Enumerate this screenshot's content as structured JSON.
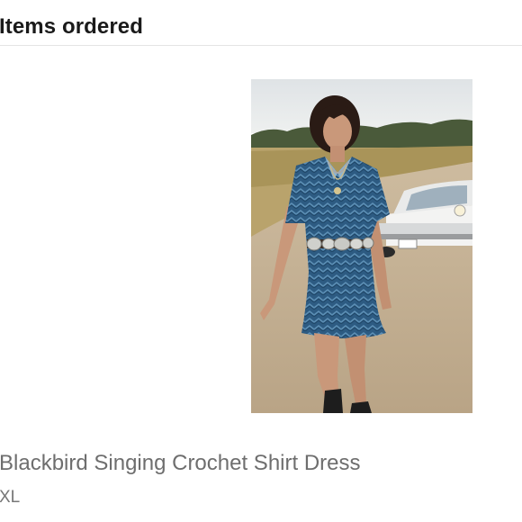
{
  "section": {
    "title": "Items ordered"
  },
  "item": {
    "name": "Blackbird Singing Crochet Shirt Dress",
    "size": "XL",
    "image_alt": "Model wearing blue crochet shirt dress with concho belt on a dirt road beside a vintage white car"
  },
  "colors": {
    "title_text": "#1a1a1a",
    "item_text": "#6e6e6e",
    "divider": "#e4e4e4",
    "dress_blue": "#2f5f86"
  }
}
